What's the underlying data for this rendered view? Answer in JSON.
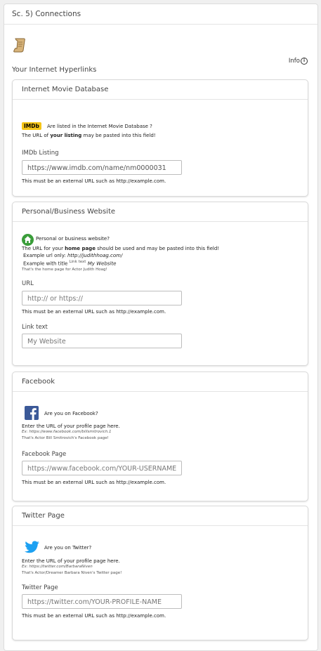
{
  "section": {
    "title": "Sc. 5) Connections",
    "info_label": "Info",
    "subtitle": "Your Internet Hyperlinks"
  },
  "imdb": {
    "header": "Internet Movie Database",
    "logo_text": "IMDb",
    "question": "Are listed in the Internet Movie Database ?",
    "paste_pre": "The URL of ",
    "paste_bold": "your listing",
    "paste_post": " may be pasted into this field!",
    "field_label": "IMDb Listing",
    "field_value": "https://www.imdb.com/name/nm0000031",
    "hint": "This must be an external URL such as http://example.com."
  },
  "website": {
    "header": "Personal/Business Website",
    "question": "Personal or business website?",
    "url_pre": "The URL for your ",
    "url_bold": "home page",
    "url_post": " should be used and may be pasted into this field!",
    "example_url_label": "Example url only: ",
    "example_url": "http://judithhoag.com/",
    "example_title_label": "Example with title",
    "example_title_sup": "Link text",
    "example_title": "My Website",
    "example_note": "That's the home page for Actor Judith Hoag!",
    "url_label": "URL",
    "url_placeholder": "http:// or https://",
    "url_hint": "This must be an external URL such as http://example.com.",
    "link_label": "Link text",
    "link_placeholder": "My Website"
  },
  "facebook": {
    "header": "Facebook",
    "question": "Are you on Facebook?",
    "instruction": "Enter the URL of your profile page here.",
    "example": "Ex: https://www.facebook.com/billsmitrovich.1",
    "example_note": "That's Actor Bill Smitrovich's Facebook page!",
    "field_label": "Facebook Page",
    "field_placeholder": "https://www.facebook.com/YOUR-USERNAME",
    "hint": "This must be an external URL such as http://example.com."
  },
  "twitter": {
    "header": "Twitter Page",
    "question": "Are you on Twitter?",
    "instruction": "Enter the URL of your profile page here.",
    "example": "Ex: https://twitter.com/BarbaraNiven",
    "example_note": "That's Actor/Dreamer Barbara Niven's Twitter page!",
    "field_label": "Twitter Page",
    "field_placeholder": "https://twitter.com/YOUR-PROFILE-NAME",
    "hint": "This must be an external URL such as http://example.com."
  },
  "colors": {
    "imdb_yellow": "#f5c518",
    "facebook_blue": "#3b5998",
    "twitter_blue": "#1da1f2",
    "home_green": "#3a9d3a"
  }
}
